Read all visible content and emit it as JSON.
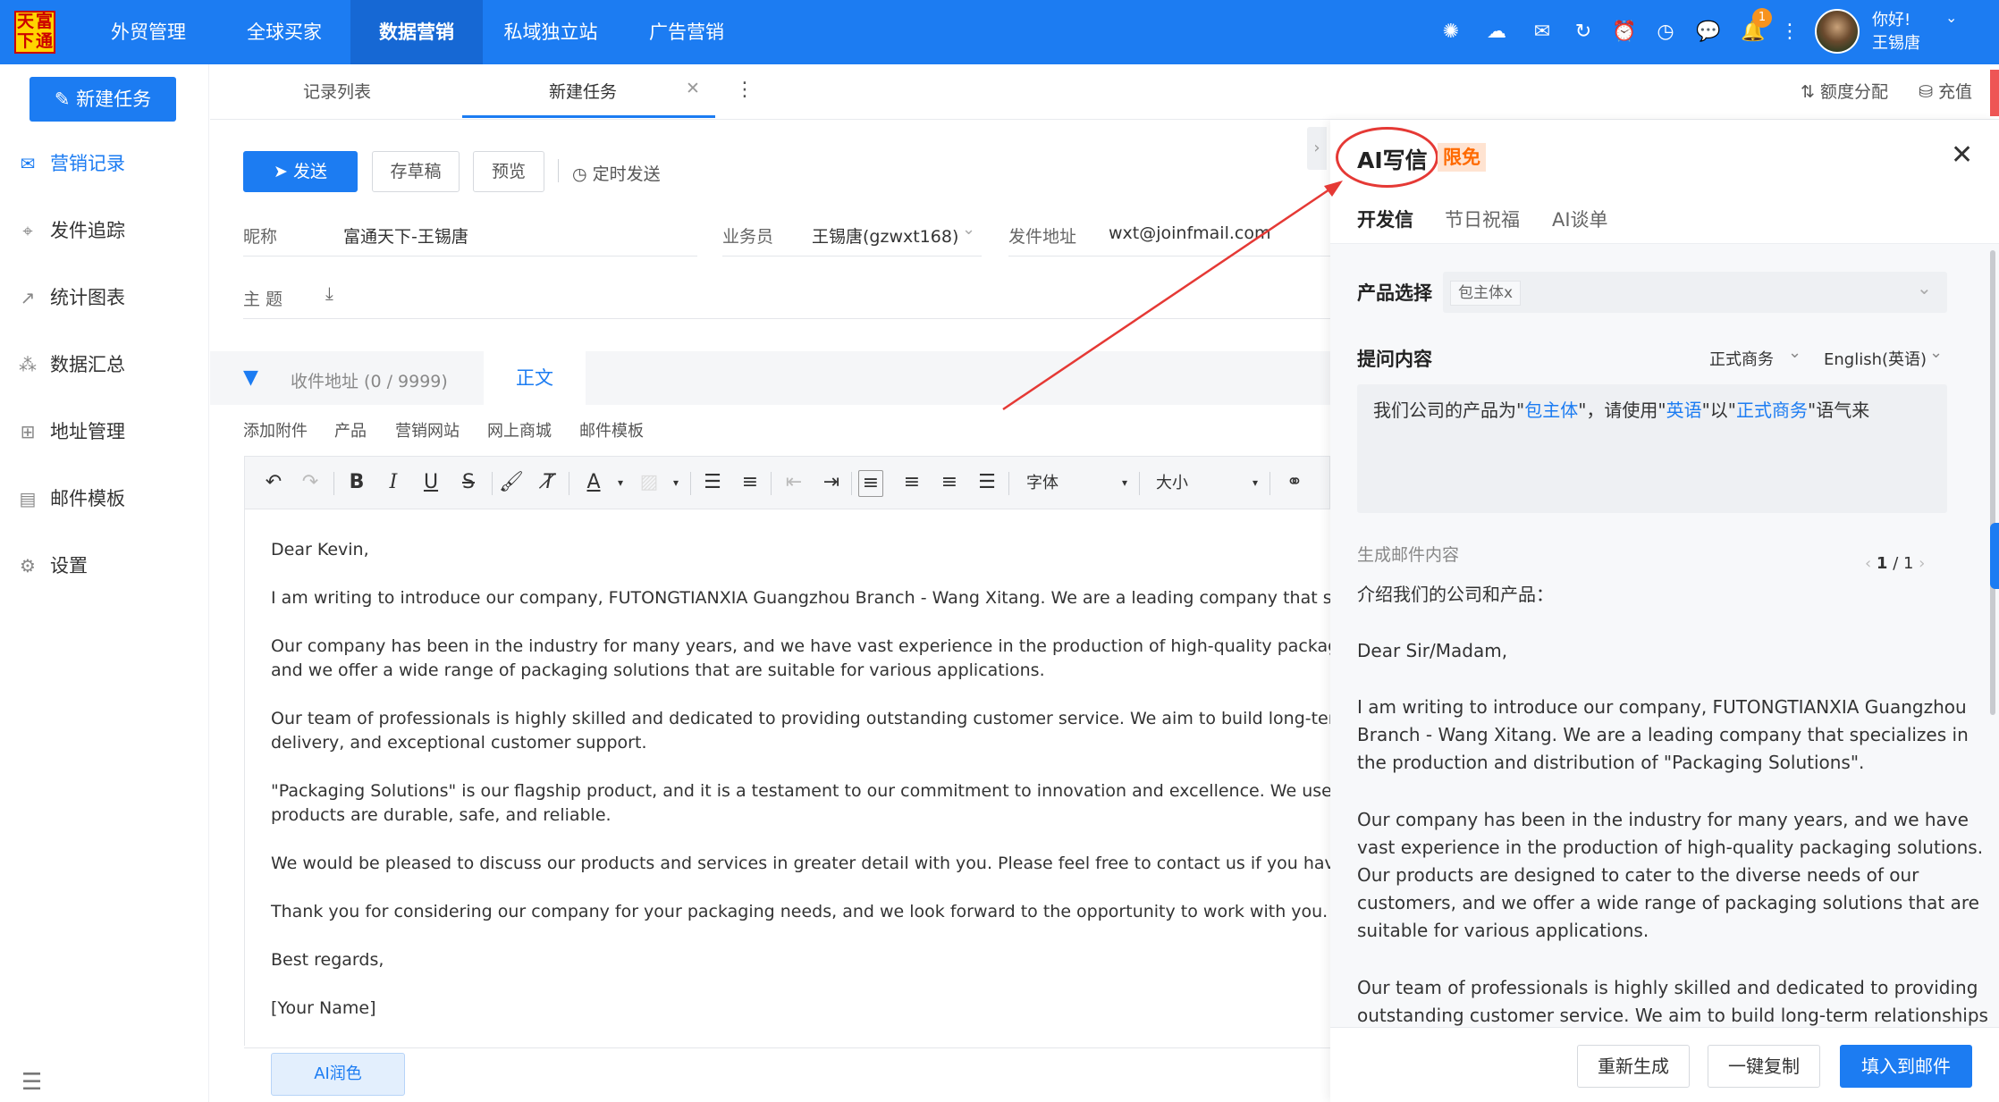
{
  "logo": {
    "chars": [
      "天",
      "富",
      "下",
      "通"
    ]
  },
  "topnav": {
    "items": [
      "外贸管理",
      "全球买家",
      "数据营销",
      "私域独立站",
      "广告营销"
    ],
    "active_index": 2,
    "icons": [
      "openai-icon",
      "cloud-icon",
      "chat-bubble-icon",
      "refresh-icon",
      "alarm-icon",
      "clock-icon",
      "message-icon",
      "bell-icon",
      "more-icon"
    ],
    "badge": "1",
    "greeting": "你好!",
    "user": "王锡唐"
  },
  "sidebar": {
    "new_task": "新建任务",
    "items": [
      {
        "label": "营销记录",
        "icon": "mail-icon",
        "active": true
      },
      {
        "label": "发件追踪",
        "icon": "location-icon",
        "active": false
      },
      {
        "label": "统计图表",
        "icon": "chart-icon",
        "active": false
      },
      {
        "label": "数据汇总",
        "icon": "cluster-icon",
        "active": false
      },
      {
        "label": "地址管理",
        "icon": "grid-icon",
        "active": false
      },
      {
        "label": "邮件模板",
        "icon": "template-icon",
        "active": false
      },
      {
        "label": "设置",
        "icon": "gear-icon",
        "active": false
      }
    ]
  },
  "tabs": {
    "record_list": "记录列表",
    "new_task": "新建任务",
    "quota": "额度分配",
    "recharge": "充值"
  },
  "toolbar": {
    "send": "发送",
    "draft": "存草稿",
    "preview": "预览",
    "schedule": "定时发送"
  },
  "form": {
    "nickname_label": "昵称",
    "nickname": "富通天下-王锡唐",
    "salesman_label": "业务员",
    "salesman": "王锡唐(gzwxt168)",
    "from_label": "发件地址",
    "from": "wxt@joinfmail.com",
    "subject_label": "主 题"
  },
  "recv": {
    "label": "收件地址 (0 / 9999)",
    "body_tab": "正文"
  },
  "links": [
    "添加附件",
    "产品",
    "营销网站",
    "网上商城",
    "邮件模板"
  ],
  "editor_tb": {
    "font": "字体",
    "size": "大小"
  },
  "editor": {
    "lines": [
      "Dear Kevin,",
      "I am writing to introduce our company, FUTONGTIANXIA Guangzhou Branch - Wang Xitang. We are a leading company that specializes in",
      "Our company has been in the industry for many years, and we have vast experience in the production of high-quality packaging solutions",
      "and we offer a wide range of packaging solutions that are suitable for various applications.",
      "Our team of professionals is highly skilled and dedicated to providing outstanding customer service. We aim to build long-term relationsh",
      "delivery, and exceptional customer support.",
      "\"Packaging Solutions\" is our flagship product, and it is a testament to our commitment to innovation and excellence. We use only the highe",
      "products are durable, safe, and reliable.",
      "We would be pleased to discuss our products and services in greater detail with you. Please feel free to contact us if you have any questio",
      "Thank you for considering our company for your packaging needs, and we look forward to the opportunity to work with you.",
      "Best regards,",
      "[Your Name]"
    ],
    "ai_polish": "AI润色"
  },
  "panel": {
    "title": "AI写信",
    "badge": "限免",
    "tabs": [
      "开发信",
      "节日祝福",
      "AI谈单"
    ],
    "product_label": "产品选择",
    "product_tag": "包主体x",
    "prompt_label": "提问内容",
    "tone": "正式商务",
    "lang": "English(英语)",
    "prompt": {
      "p1": "我们公司的产品为\"",
      "h1": "包主体",
      "p2": "\"，请使用\"",
      "h2": "英语",
      "p3": "\"以\"",
      "h3": "正式商务",
      "p4": "\"语气来"
    },
    "gen_label": "生成邮件内容",
    "pager_cur": "1",
    "pager_total": "/ 1",
    "gen_lines": [
      "介绍我们的公司和产品：",
      "Dear Sir/Madam,",
      "I am writing to introduce our company, FUTONGTIANXIA Guangzhou",
      "Branch - Wang Xitang. We are a leading company that specializes in",
      "the production and distribution of \"Packaging Solutions\".",
      "Our company has been in the industry for many years, and we have",
      "vast experience in the production of high-quality packaging solutions.",
      "Our products are designed to cater to the diverse needs of our",
      "customers, and we offer a wide range of packaging solutions that are",
      "suitable for various applications.",
      "Our team of professionals is highly skilled and dedicated to providing",
      "outstanding customer service. We aim to build long-term relationships"
    ],
    "regen": "重新生成",
    "copy": "一键复制",
    "fill": "填入到邮件"
  }
}
